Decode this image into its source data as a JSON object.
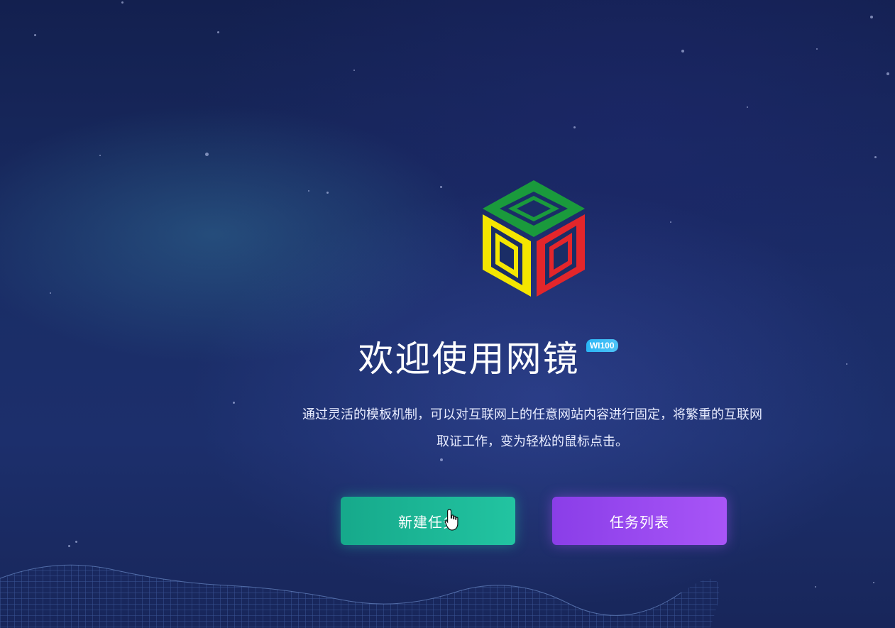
{
  "app": {
    "title": "欢迎使用网镜",
    "badge": "WI100"
  },
  "description": {
    "line1": "通过灵活的模板机制，可以对互联网上的任意网站内容进行固定，将繁重的互联网",
    "line2": "取证工作，变为轻松的鼠标点击。"
  },
  "actions": {
    "new_task_label": "新建任务",
    "task_list_label": "任务列表"
  },
  "icons": {
    "logo": "cube-logo-icon",
    "cursor": "hand-pointer-icon"
  },
  "colors": {
    "logo_green": "#1a9a3c",
    "logo_yellow": "#f4e600",
    "logo_red": "#e3262b",
    "new_task_button": "#1eb596",
    "task_list_button": "#9b4cf2",
    "badge": "#29b6f6"
  }
}
